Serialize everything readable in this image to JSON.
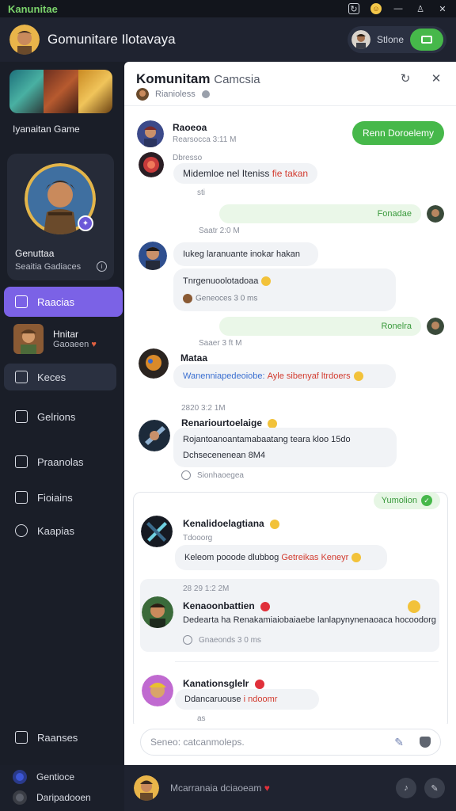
{
  "window": {
    "app_name": "Kanunitae",
    "icons": [
      "refresh-icon",
      "emoji-notification-icon",
      "minimize-icon",
      "user-icon",
      "close-icon"
    ]
  },
  "header": {
    "title": "Gomunitare Ilotavaya",
    "status_label": "Stlone",
    "toggle_icon": "video-icon"
  },
  "sidebar": {
    "game_name": "Iyanaitan Game",
    "profile": {
      "name": "Genuttaa",
      "subtitle": "Seaitia Gadiaces"
    },
    "nav": {
      "item1": "Raacias",
      "friend_name": "Hnitar",
      "friend_sub": "Gaoaeen",
      "item2": "Keces",
      "item3": "Gelrions",
      "item4": "Praanolas",
      "item5": "Fioiains",
      "item6": "Kaapias",
      "item7": "Raanses"
    },
    "status": {
      "online": "Gentioce",
      "offline": "Daripadooen"
    }
  },
  "panel": {
    "title_bold": "Komunitam",
    "title_light": "Camcsia",
    "subtitle": "Rianioless",
    "join_button": "Renn Doroelemy",
    "compose_placeholder": "Seneo: catcanmoleps.",
    "messages": {
      "m1": {
        "name": "Raoeoa",
        "meta": "Rearsocca 3:11 M"
      },
      "m2": {
        "meta": "Dbresso",
        "text_pre": "Midemloe nel Iteniss",
        "text_red": "fie takan"
      },
      "m2_time": "sti",
      "own1": {
        "text": "Fonadae"
      },
      "time1": "Saatr  2:0 M",
      "m3": {
        "text1": "Iukeg laranuante inokar hakan",
        "text2": "Tnrgenuoolotadoaa",
        "react": "Geneoces  3 0 ms"
      },
      "own2": {
        "text": "Ronelra"
      },
      "time2": "Saaer  3 ft  M",
      "m4": {
        "name": "Mataa",
        "text_blue": "Wanenniapedeoiobe:",
        "text_red": "Ayle sibenyaf ltrdoers"
      },
      "time3": "2820 3:2 1M",
      "m5": {
        "name": "Renariourtoelaige",
        "text1": "Rojantoanoantamabaatang teara kloo",
        "text1_end": "15do",
        "text2": "Dchsecenenean",
        "text2_end": "8M4",
        "react": "Sionhaoegea"
      },
      "card": {
        "tag": "Yumolion",
        "m6": {
          "name": "Kenalidoelagtiana",
          "meta": "Tdooorg",
          "text_pre": "Keleom pooode dlubbog",
          "text_red": "Getreikas Keneyr"
        },
        "time": "28 29 1:2 2M",
        "m7": {
          "name": "Kenaoonbattien",
          "text": "Dedearta ha Renakamiaiobaiaebe lanlapynynenaoaca hocoodorg",
          "react": "Gnaeonds  3 0 ms"
        },
        "m8": {
          "name": "Kanationsglelr",
          "text_pre": "Ddancaruouse",
          "text_red": "i ndoomr"
        },
        "time_end": "as"
      }
    }
  },
  "footer": {
    "name": "Mcarranaia dciaoeam"
  }
}
